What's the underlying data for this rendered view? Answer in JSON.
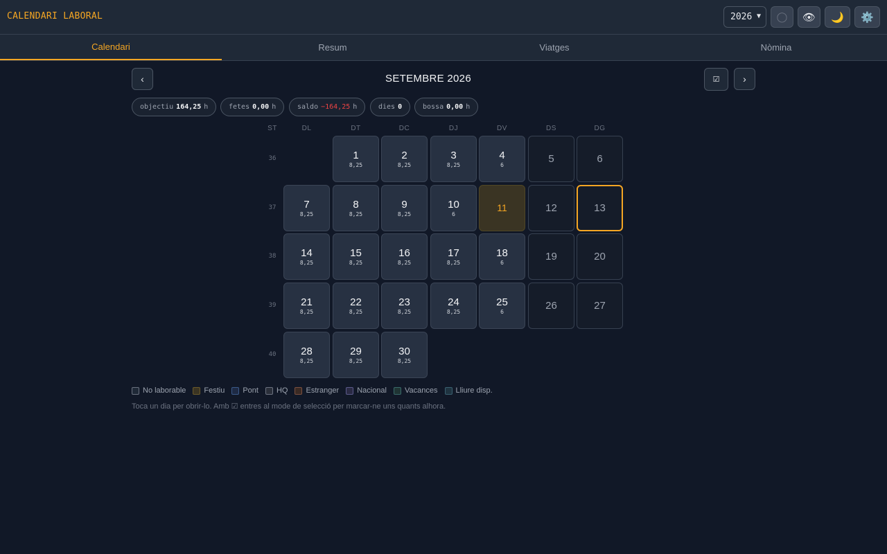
{
  "header": {
    "app_title": "CALENDARI LABORAL",
    "year_value": "2026",
    "icons": [
      "circle-icon",
      "eye-icon",
      "moon-icon",
      "gear-icon"
    ],
    "icon_glyphs": [
      "◯",
      "👁",
      "🌙",
      "⚙️"
    ]
  },
  "tabs": [
    {
      "label": "Calendari",
      "active": true
    },
    {
      "label": "Resum",
      "active": false
    },
    {
      "label": "Viatges",
      "active": false
    },
    {
      "label": "Nòmina",
      "active": false
    }
  ],
  "nav": {
    "prev": "‹",
    "next": "›",
    "select_mode": "☑",
    "month_title": "SETEMBRE 2026"
  },
  "stats": {
    "objectiu_label": "objectiu",
    "objectiu_value": "164,25",
    "objectiu_unit": "h",
    "fetes_label": "fetes",
    "fetes_value": "0,00",
    "fetes_unit": "h",
    "saldo_label": "saldo",
    "saldo_value": "−164,25",
    "saldo_unit": "h",
    "dies_label": "dies",
    "dies_value": "0",
    "bossa_label": "bossa",
    "bossa_value": "0,00",
    "bossa_unit": "h"
  },
  "calendar": {
    "week_col_label": "ST",
    "weekdays": [
      "DL",
      "DT",
      "DC",
      "DJ",
      "DV",
      "DS",
      "DG"
    ],
    "weeks": [
      {
        "num": "36",
        "days": [
          null,
          {
            "day": "1",
            "hours": "8,25",
            "type": "work"
          },
          {
            "day": "2",
            "hours": "8,25",
            "type": "work"
          },
          {
            "day": "3",
            "hours": "8,25",
            "type": "work"
          },
          {
            "day": "4",
            "hours": "6",
            "type": "work"
          },
          {
            "day": "5",
            "hours": "",
            "type": "weekend"
          },
          {
            "day": "6",
            "hours": "",
            "type": "weekend"
          }
        ]
      },
      {
        "num": "37",
        "days": [
          {
            "day": "7",
            "hours": "8,25",
            "type": "work"
          },
          {
            "day": "8",
            "hours": "8,25",
            "type": "work"
          },
          {
            "day": "9",
            "hours": "8,25",
            "type": "work"
          },
          {
            "day": "10",
            "hours": "6",
            "type": "work"
          },
          {
            "day": "11",
            "hours": "",
            "type": "holiday"
          },
          {
            "day": "12",
            "hours": "",
            "type": "weekend"
          },
          {
            "day": "13",
            "hours": "",
            "type": "today"
          }
        ]
      },
      {
        "num": "38",
        "days": [
          {
            "day": "14",
            "hours": "8,25",
            "type": "work"
          },
          {
            "day": "15",
            "hours": "8,25",
            "type": "work"
          },
          {
            "day": "16",
            "hours": "8,25",
            "type": "work"
          },
          {
            "day": "17",
            "hours": "8,25",
            "type": "work"
          },
          {
            "day": "18",
            "hours": "6",
            "type": "work"
          },
          {
            "day": "19",
            "hours": "",
            "type": "weekend"
          },
          {
            "day": "20",
            "hours": "",
            "type": "weekend"
          }
        ]
      },
      {
        "num": "39",
        "days": [
          {
            "day": "21",
            "hours": "8,25",
            "type": "work"
          },
          {
            "day": "22",
            "hours": "8,25",
            "type": "work"
          },
          {
            "day": "23",
            "hours": "8,25",
            "type": "work"
          },
          {
            "day": "24",
            "hours": "8,25",
            "type": "work"
          },
          {
            "day": "25",
            "hours": "6",
            "type": "work"
          },
          {
            "day": "26",
            "hours": "",
            "type": "weekend"
          },
          {
            "day": "27",
            "hours": "",
            "type": "weekend"
          }
        ]
      },
      {
        "num": "40",
        "days": [
          {
            "day": "28",
            "hours": "8,25",
            "type": "work"
          },
          {
            "day": "29",
            "hours": "8,25",
            "type": "work"
          },
          {
            "day": "30",
            "hours": "8,25",
            "type": "work"
          },
          null,
          null,
          null,
          null
        ]
      }
    ]
  },
  "legend": [
    {
      "label": "No laborable",
      "color": "#1f2937",
      "border": "#6b7280"
    },
    {
      "label": "Festiu",
      "color": "#3a3423",
      "border": "#6b5a2a"
    },
    {
      "label": "Pont",
      "color": "#1e2a44",
      "border": "#3b5a8a"
    },
    {
      "label": "HQ",
      "color": "#2a2f3a",
      "border": "#6b7280"
    },
    {
      "label": "Estranger",
      "color": "#3a2a24",
      "border": "#7a5040"
    },
    {
      "label": "Nacional",
      "color": "#2a2a44",
      "border": "#5a5a8a"
    },
    {
      "label": "Vacances",
      "color": "#1f3434",
      "border": "#3a6a6a"
    },
    {
      "label": "Lliure disp.",
      "color": "#1f3340",
      "border": "#3a6070"
    }
  ],
  "hint": "Toca un dia per obrir-lo. Amb ☑ entres al mode de selecció per marcar-ne uns quants alhora."
}
